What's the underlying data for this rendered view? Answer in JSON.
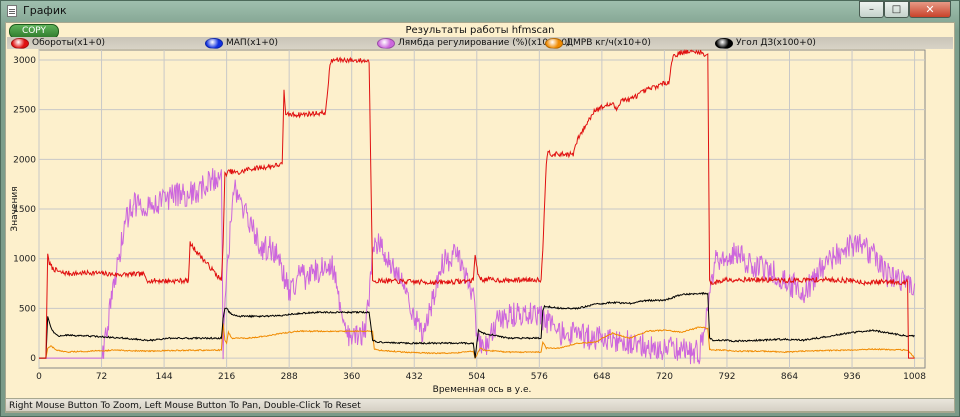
{
  "window": {
    "title": "График",
    "minimize_glyph": "–",
    "maximize_glyph": "□",
    "close_glyph": "✕"
  },
  "copy_button": {
    "label": "COPY"
  },
  "status_text": "Right Mouse Button To Zoom, Left Mouse Button To Pan, Double-Click To Reset",
  "chart_data": {
    "type": "line",
    "title": "Результаты работы hfmscan",
    "xlabel": "Временная ось в у.е.",
    "ylabel": "Значения",
    "xlim": [
      0,
      1020
    ],
    "ylim": [
      -100,
      3100
    ],
    "x_ticks": [
      0,
      72,
      144,
      216,
      288,
      360,
      432,
      504,
      576,
      648,
      720,
      792,
      864,
      936,
      1008
    ],
    "y_ticks": [
      0,
      500,
      1000,
      1500,
      2000,
      2500,
      3000
    ],
    "grid": true,
    "legend_position": "top",
    "series": [
      {
        "name": "Обороты(x1+0)",
        "color": "#e01010",
        "noise": 25,
        "x": [
          0,
          8,
          10,
          12,
          16,
          25,
          40,
          60,
          90,
          120,
          126,
          128,
          150,
          172,
          174,
          210,
          212,
          214,
          220,
          230,
          240,
          260,
          280,
          282,
          284,
          286,
          300,
          330,
          335,
          337,
          340,
          350,
          380,
          384,
          386,
          388,
          420,
          460,
          500,
          502,
          506,
          510,
          520,
          540,
          560,
          578,
          580,
          584,
          586,
          590,
          600,
          615,
          620,
          640,
          660,
          665,
          670,
          680,
          700,
          725,
          730,
          734,
          740,
          760,
          768,
          770,
          772,
          776,
          790,
          820,
          860,
          900,
          938,
          950,
          980,
          996,
          1000,
          1001,
          1004,
          1008
        ],
        "y": [
          0,
          0,
          1050,
          950,
          900,
          860,
          850,
          860,
          840,
          845,
          770,
          780,
          775,
          780,
          1150,
          780,
          1150,
          1850,
          1880,
          1860,
          1900,
          1920,
          1950,
          2700,
          2450,
          2450,
          2450,
          2470,
          2950,
          2990,
          3000,
          3000,
          2990,
          780,
          770,
          780,
          770,
          760,
          780,
          1050,
          820,
          790,
          790,
          780,
          790,
          790,
          1100,
          1950,
          2100,
          2050,
          2050,
          2050,
          2200,
          2500,
          2560,
          2500,
          2600,
          2600,
          2700,
          2780,
          3050,
          3050,
          3080,
          3080,
          3050,
          3060,
          770,
          750,
          790,
          790,
          780,
          790,
          780,
          760,
          770,
          760,
          770,
          0,
          0,
          0
        ]
      },
      {
        "name": "МАП(x1+0)",
        "color": "#1030e0",
        "noise": 0,
        "x": [],
        "y": []
      },
      {
        "name": "Лямбда регулирование (%)(x100+0)",
        "color": "#cc66dd",
        "noise": 130,
        "x": [
          0,
          60,
          72,
          80,
          90,
          100,
          110,
          130,
          160,
          180,
          200,
          208,
          210,
          212,
          215,
          225,
          240,
          255,
          270,
          290,
          300,
          310,
          330,
          340,
          350,
          360,
          375,
          385,
          390,
          400,
          420,
          435,
          440,
          450,
          465,
          480,
          500,
          505,
          512,
          530,
          560,
          580,
          600,
          640,
          680,
          720,
          760,
          780,
          800,
          820,
          850,
          880,
          900,
          920,
          940,
          960,
          980,
          1000,
          1008
        ],
        "y": [
          0,
          0,
          0,
          400,
          900,
          1400,
          1550,
          1550,
          1650,
          1650,
          1800,
          1800,
          1900,
          100,
          800,
          1700,
          1400,
          1100,
          1100,
          650,
          850,
          800,
          950,
          900,
          300,
          200,
          250,
          1050,
          1150,
          1050,
          750,
          350,
          250,
          500,
          950,
          1050,
          600,
          150,
          50,
          400,
          450,
          400,
          250,
          200,
          150,
          100,
          50,
          1000,
          1050,
          950,
          850,
          650,
          900,
          1050,
          1150,
          1050,
          800,
          750,
          750
        ]
      },
      {
        "name": "ДМРВ кг/ч(x10+0)",
        "color": "#f08a00",
        "noise": 6,
        "x": [
          0,
          8,
          10,
          14,
          20,
          30,
          60,
          90,
          120,
          150,
          200,
          210,
          212,
          214,
          216,
          218,
          222,
          240,
          260,
          280,
          300,
          320,
          360,
          384,
          386,
          390,
          420,
          450,
          480,
          500,
          502,
          508,
          512,
          540,
          578,
          580,
          584,
          600,
          620,
          640,
          660,
          680,
          700,
          720,
          740,
          760,
          770,
          772,
          776,
          790,
          800,
          830,
          860,
          880,
          930,
          960,
          1000,
          1008
        ],
        "y": [
          0,
          0,
          100,
          120,
          80,
          60,
          70,
          80,
          70,
          75,
          80,
          80,
          350,
          180,
          150,
          260,
          200,
          200,
          220,
          250,
          270,
          270,
          270,
          270,
          90,
          80,
          60,
          50,
          50,
          70,
          0,
          100,
          80,
          60,
          60,
          160,
          100,
          100,
          150,
          160,
          250,
          200,
          270,
          280,
          260,
          310,
          300,
          90,
          80,
          80,
          70,
          70,
          60,
          70,
          80,
          90,
          80,
          0
        ]
      },
      {
        "name": "Угол ДЗ(x100+0)",
        "color": "#000000",
        "noise": 8,
        "x": [
          0,
          8,
          10,
          14,
          18,
          24,
          30,
          60,
          100,
          120,
          130,
          150,
          180,
          210,
          212,
          214,
          216,
          220,
          230,
          240,
          260,
          280,
          300,
          320,
          350,
          380,
          384,
          390,
          420,
          450,
          480,
          500,
          502,
          506,
          512,
          540,
          578,
          580,
          582,
          600,
          620,
          640,
          660,
          680,
          700,
          720,
          740,
          760,
          770,
          772,
          776,
          790,
          800,
          830,
          860,
          880,
          910,
          930,
          960,
          1000,
          1008
        ],
        "y": [
          0,
          0,
          420,
          300,
          250,
          220,
          230,
          220,
          200,
          180,
          180,
          200,
          200,
          200,
          400,
          500,
          500,
          450,
          420,
          420,
          420,
          430,
          450,
          460,
          460,
          460,
          180,
          160,
          150,
          150,
          150,
          150,
          0,
          280,
          250,
          200,
          200,
          480,
          520,
          500,
          500,
          540,
          560,
          550,
          580,
          580,
          640,
          650,
          650,
          200,
          180,
          180,
          170,
          180,
          190,
          180,
          220,
          250,
          280,
          220,
          220
        ]
      }
    ]
  }
}
